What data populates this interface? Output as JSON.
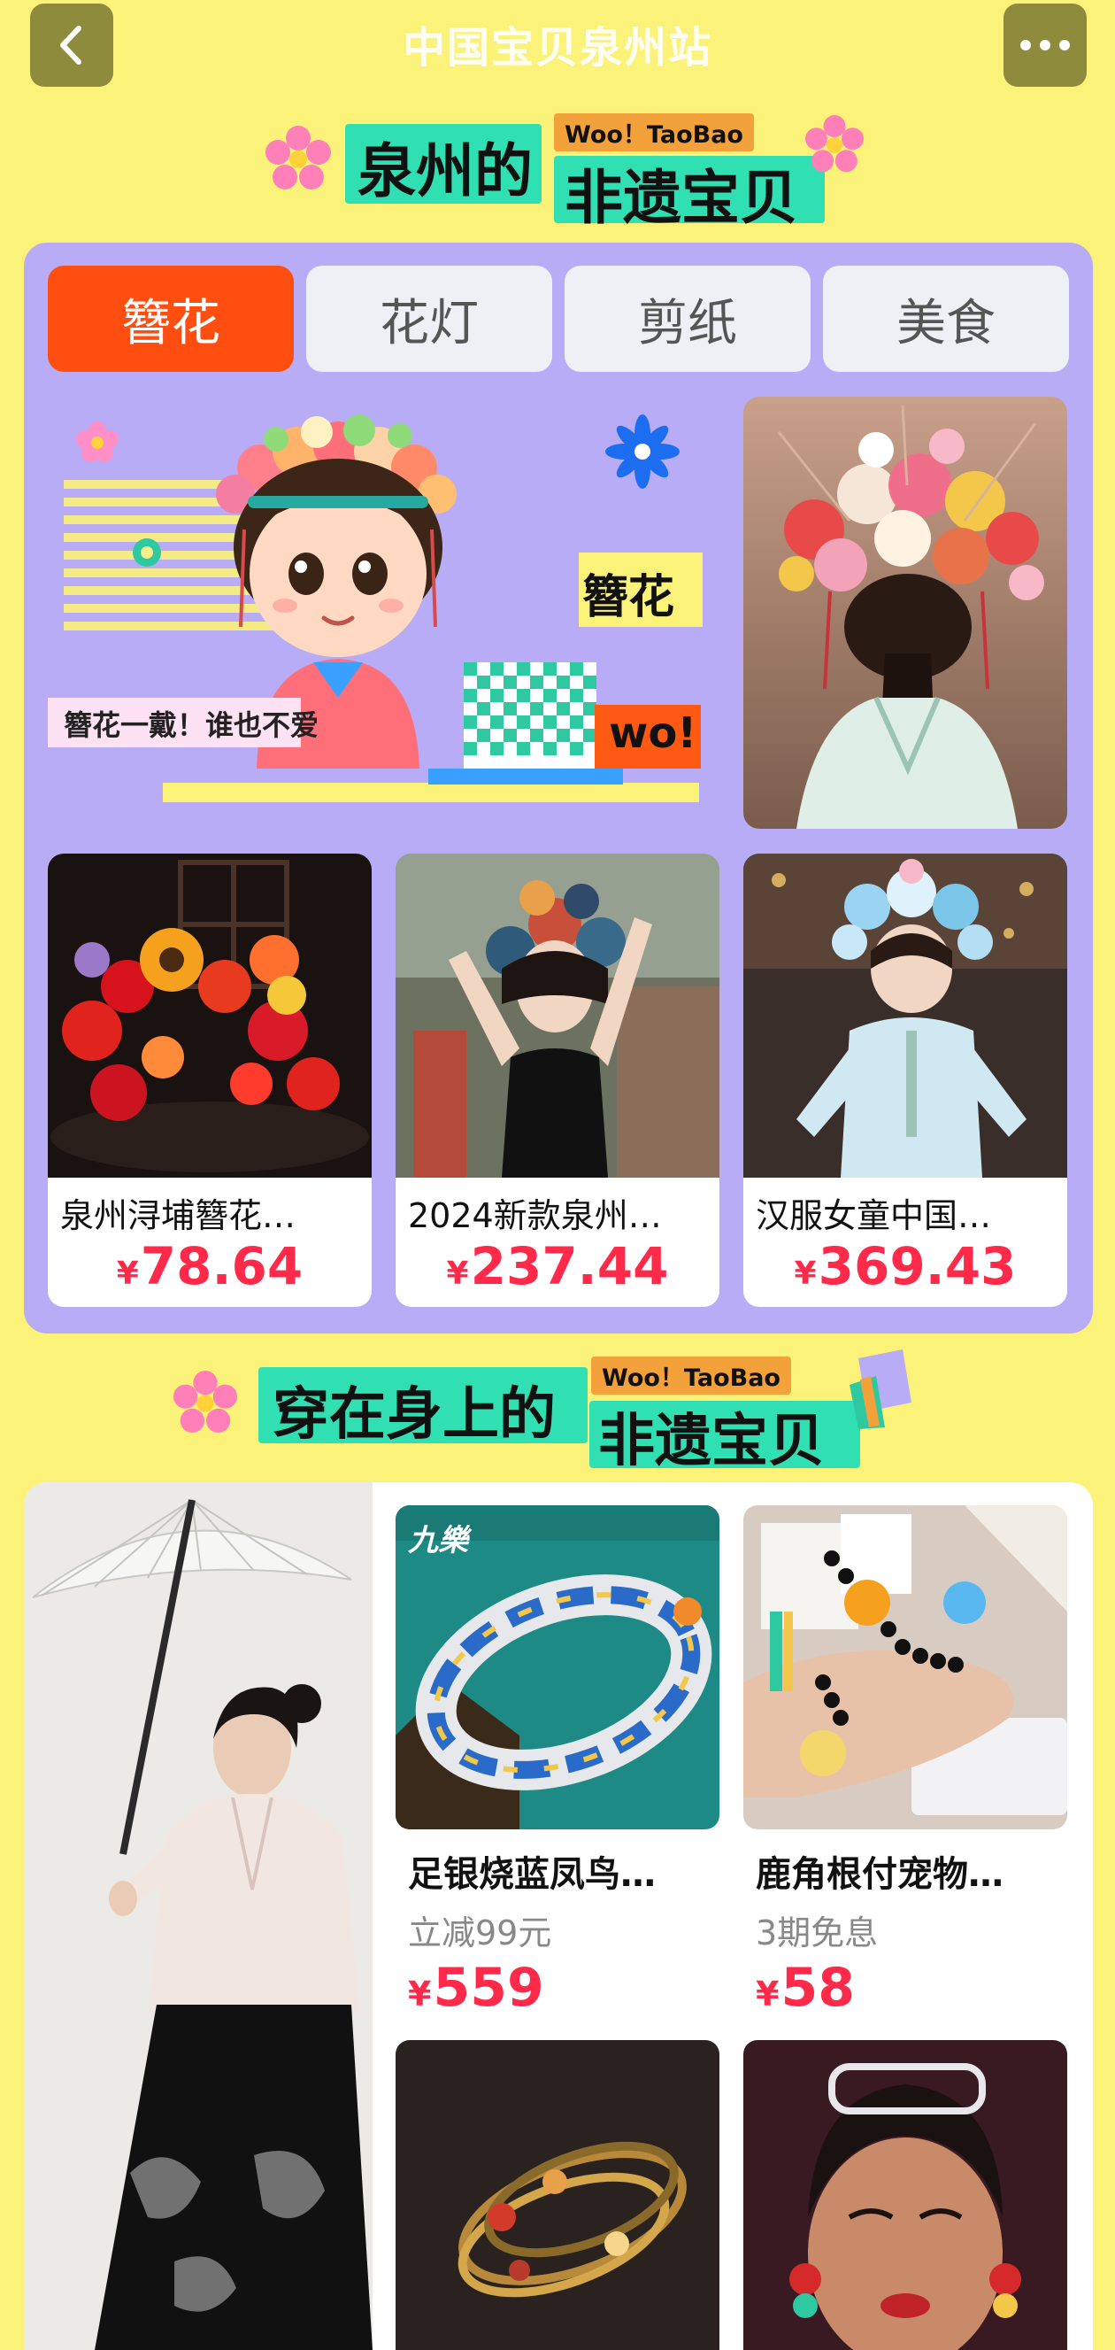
{
  "header": {
    "title": "中国宝贝泉州站",
    "back_icon": "chevron-left-icon",
    "more_icon": "more-dots-icon"
  },
  "section1": {
    "headline_left": "泉州的",
    "headline_tag": "Woo！TaoBao",
    "headline_right": "非遗宝贝",
    "tabs": [
      {
        "label": "簪花",
        "active": true
      },
      {
        "label": "花灯",
        "active": false
      },
      {
        "label": "剪纸",
        "active": false
      },
      {
        "label": "美食",
        "active": false
      }
    ],
    "promo_banner": {
      "caption": "簪花一戴！谁也不爱",
      "label": "簪花",
      "wo": "wo!"
    },
    "products": [
      {
        "name": "泉州浔埔簪花…",
        "currency": "¥",
        "price": "78.64"
      },
      {
        "name": "2024新款泉州…",
        "currency": "¥",
        "price": "237.44"
      },
      {
        "name": "汉服女童中国…",
        "currency": "¥",
        "price": "369.43"
      }
    ]
  },
  "section2": {
    "headline_left": "穿在身上的",
    "headline_tag": "Woo！TaoBao",
    "headline_right": "非遗宝贝",
    "goods": [
      {
        "name": "足银烧蓝凤鸟…",
        "promo": "立减99元",
        "currency": "¥",
        "price": "559",
        "brand_logo": "九樂"
      },
      {
        "name": "鹿角根付宠物…",
        "promo": "3期免息",
        "currency": "¥",
        "price": "58"
      }
    ]
  },
  "colors": {
    "background": "#fbf27a",
    "panel": "#b9acf6",
    "accent": "#ff4e10",
    "price": "#ff2a4a",
    "headline_green": "#30dfb2",
    "tag_orange": "#f3a13a"
  }
}
